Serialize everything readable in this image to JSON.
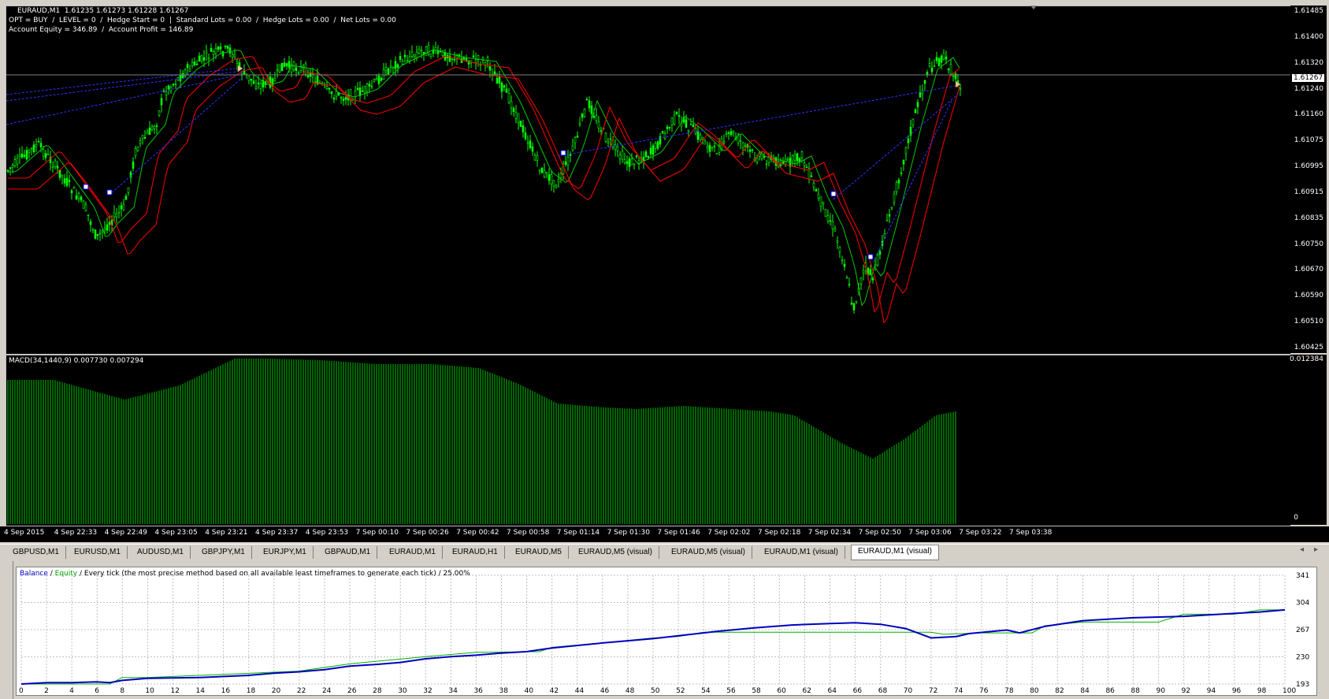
{
  "chart": {
    "symbol_line": "EURAUD,M1  1.61235 1.61273 1.61228 1.61267",
    "info_line1": "OPT = BUY  /  LEVEL = 0  /  Hedge Start = 0  |  Standard Lots = 0.00  /  Hedge Lots = 0.00  /  Net Lots = 0.00",
    "info_line2": "Account Equity = 346.89  /  Account Profit = 146.89",
    "current_price": "1.61267",
    "price_labels": [
      "1.61485",
      "1.61400",
      "1.61320",
      "1.61240",
      "1.61160",
      "1.61075",
      "1.60995",
      "1.60915",
      "1.60835",
      "1.60750",
      "1.60670",
      "1.60590",
      "1.60510",
      "1.60425"
    ],
    "price_min": 1.60425,
    "price_max": 1.61485,
    "colors": {
      "candle": "#00ff00",
      "ma_fast": "#00c800",
      "ma_slow": "#ff0000",
      "trend": "#0000ff",
      "macd": "#00c800"
    }
  },
  "macd": {
    "label": "MACD(34,1440,9) 0.007730 0.007294",
    "top_value": "0.012384",
    "bottom_value": "0"
  },
  "time_labels": [
    "4 Sep 2015",
    "4 Sep 22:33",
    "4 Sep 22:49",
    "4 Sep 23:05",
    "4 Sep 23:21",
    "4 Sep 23:37",
    "4 Sep 23:53",
    "7 Sep 00:10",
    "7 Sep 00:26",
    "7 Sep 00:42",
    "7 Sep 00:58",
    "7 Sep 01:14",
    "7 Sep 01:30",
    "7 Sep 01:46",
    "7 Sep 02:02",
    "7 Sep 02:18",
    "7 Sep 02:34",
    "7 Sep 02:50",
    "7 Sep 03:06",
    "7 Sep 03:22",
    "7 Sep 03:38"
  ],
  "tabs": [
    "GBPUSD,M1",
    "EURUSD,M1",
    "AUDUSD,M1",
    "GBPJPY,M1",
    "EURJPY,M1",
    "GBPAUD,M1",
    "EURAUD,M1",
    "EURAUD,H1",
    "EURAUD,M5",
    "EURAUD,M5 (visual)",
    "EURAUD,M5 (visual)",
    "EURAUD,M1 (visual)",
    "EURAUD,M1 (visual)"
  ],
  "active_tab": 12,
  "tester": {
    "legend_balance": "Balance",
    "legend_sep": " / ",
    "legend_equity": "Equity",
    "legend_rest": " / Every tick (the most precise method based on all available least timeframes to generate each tick) / 25.00%",
    "y_labels": [
      "341",
      "304",
      "267",
      "230",
      "193"
    ],
    "x_labels": [
      "0",
      "2",
      "4",
      "6",
      "8",
      "10",
      "12",
      "14",
      "16",
      "18",
      "20",
      "22",
      "24",
      "26",
      "28",
      "30",
      "32",
      "34",
      "36",
      "38",
      "40",
      "42",
      "44",
      "46",
      "48",
      "50",
      "52",
      "54",
      "56",
      "58",
      "60",
      "62",
      "64",
      "66",
      "68",
      "70",
      "72",
      "74",
      "76",
      "78",
      "80",
      "82",
      "84",
      "86",
      "88",
      "90",
      "92",
      "94",
      "96",
      "98",
      "100"
    ],
    "colors": {
      "balance": "#0000c0",
      "equity": "#00b000"
    }
  }
}
